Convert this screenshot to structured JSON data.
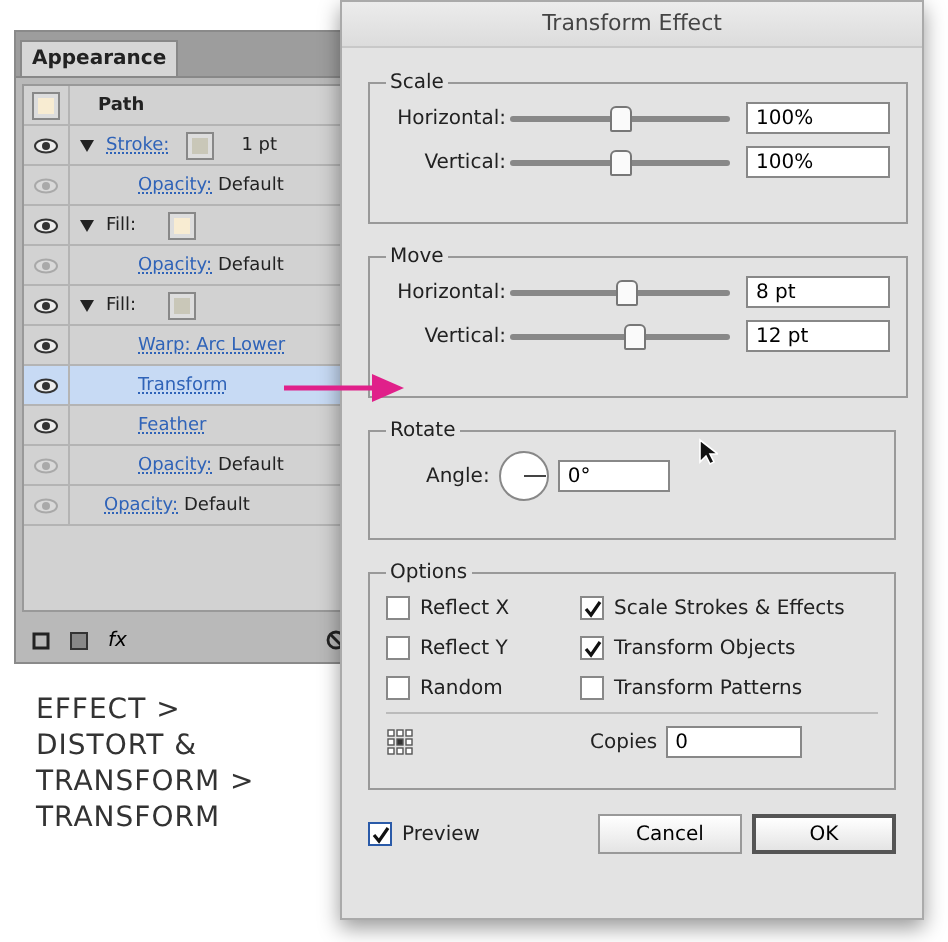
{
  "appearance_panel": {
    "tab": "Appearance",
    "header": {
      "label": "Path",
      "color": "#f8ecd2"
    },
    "rows": [
      {
        "kind": "attribute",
        "eye_active": true,
        "expanded": true,
        "link": "Stroke:",
        "color": "#c9c7b8",
        "value": "1 pt",
        "selected": false
      },
      {
        "kind": "effect",
        "eye_active": false,
        "link": "Opacity:",
        "value": "Default",
        "selected": false
      },
      {
        "kind": "attribute",
        "eye_active": true,
        "expanded": true,
        "label": "Fill:",
        "color": "#f8ecd2",
        "selected": false
      },
      {
        "kind": "effect",
        "eye_active": false,
        "link": "Opacity:",
        "value": "Default",
        "selected": false
      },
      {
        "kind": "attribute",
        "eye_active": true,
        "expanded": true,
        "label": "Fill:",
        "color": "#c9c7b8",
        "selected": false
      },
      {
        "kind": "effect",
        "eye_active": true,
        "link": "Warp: Arc Lower",
        "selected": false
      },
      {
        "kind": "effect",
        "eye_active": true,
        "link": "Transform",
        "selected": true
      },
      {
        "kind": "effect",
        "eye_active": true,
        "link": "Feather",
        "selected": false
      },
      {
        "kind": "effect",
        "eye_active": false,
        "link": "Opacity:",
        "value": "Default",
        "selected": false
      },
      {
        "kind": "top",
        "eye_active": false,
        "link": "Opacity:",
        "value": "Default",
        "selected": false
      }
    ],
    "footer": [
      "fx"
    ]
  },
  "caption": [
    "EFFECT >",
    "DISTORT &",
    "TRANSFORM >",
    "TRANSFORM"
  ],
  "dialog": {
    "title": "Transform Effect",
    "groups": [
      {
        "kind": "sliders",
        "title": "Scale",
        "sliders": [
          {
            "label": "Horizontal:",
            "level": 0.5,
            "value": "100%"
          },
          {
            "label": "Vertical:",
            "level": 0.5,
            "value": "100%"
          }
        ]
      },
      {
        "kind": "sliders",
        "title": "Move",
        "sliders": [
          {
            "label": "Horizontal:",
            "level": 0.53,
            "value": "8 pt"
          },
          {
            "label": "Vertical:",
            "level": 0.56,
            "value": "12 pt"
          }
        ]
      },
      {
        "kind": "rotate",
        "title": "Rotate",
        "label": "Angle:",
        "value": "0°"
      },
      {
        "kind": "options",
        "title": "Options",
        "options": [
          {
            "label": "Reflect X",
            "checked": false
          },
          {
            "label": "Scale Strokes & Effects",
            "checked": true
          },
          {
            "label": "Reflect Y",
            "checked": false
          },
          {
            "label": "Transform Objects",
            "checked": true
          },
          {
            "label": "Random",
            "checked": false
          },
          {
            "label": "Transform Patterns",
            "checked": false
          }
        ],
        "copies_label": "Copies",
        "copies": "0"
      }
    ],
    "preview": {
      "label": "Preview",
      "checked": true
    },
    "buttons": [
      {
        "label": "Cancel",
        "default": false
      },
      {
        "label": "OK",
        "default": true
      }
    ]
  }
}
